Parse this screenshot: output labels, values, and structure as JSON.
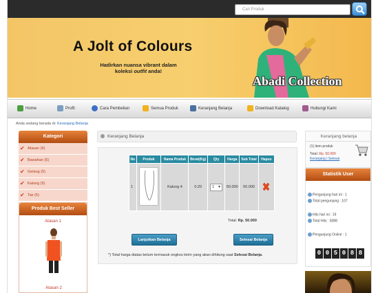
{
  "search": {
    "placeholder": "Cari Produk"
  },
  "banner": {
    "title": "A Jolt of Colours",
    "subtitle_line1": "Hadirkan nuansa vibrant dalam",
    "subtitle_line2": "koleksi outfit anda!",
    "brand": "Abadi Collection"
  },
  "nav": {
    "items": [
      {
        "label": "Home",
        "icon": "home-icon",
        "color": "#4d9e3f"
      },
      {
        "label": "Profil",
        "icon": "profile-icon",
        "color": "#7a9fc0"
      },
      {
        "label": "Cara Pembelian",
        "icon": "globe-icon",
        "color": "#3b6fc4"
      },
      {
        "label": "Semua Produk",
        "icon": "star-icon",
        "color": "#f0b21e"
      },
      {
        "label": "Keranjang Belanja",
        "icon": "cart-icon",
        "color": "#4a6fa0"
      },
      {
        "label": "Download Katalog",
        "icon": "star-icon",
        "color": "#f0b21e"
      },
      {
        "label": "Hubungi Kami",
        "icon": "contact-icon",
        "color": "#a05b8f"
      }
    ]
  },
  "breadcrumb": {
    "prefix": "Anda sedang berada di:",
    "current": "Keranjang Belanja"
  },
  "kategori": {
    "title": "Kategori",
    "items": [
      "Atasan (6)",
      "Bawahan (5)",
      "Gelang (5)",
      "Kalung (5)",
      "Tas (5)"
    ]
  },
  "bestseller": {
    "title": "Produk Best Seller",
    "items": [
      "Atasan 1",
      "Atasan 2"
    ]
  },
  "main": {
    "title": "Keranjang Belanja",
    "table": {
      "headers": [
        "No",
        "Produk",
        "Nama Produk",
        "Berat(Kg)",
        "Qty",
        "Harga",
        "Sub Total",
        "Hapus"
      ],
      "rows": [
        {
          "no": "1",
          "name": "Kalung 4",
          "berat": "0.20",
          "qty": "1",
          "harga": "50.000",
          "subtotal": "50.000"
        }
      ]
    },
    "total_label": "Total:",
    "total_value": "Rp. 50.000",
    "continue_label": "Lanjutkan Belanja",
    "checkout_label": "Selesai Belanja",
    "note_prefix": "*) Total harga diatas belum termasuk ongkos kirim yang akan dihitung saat ",
    "note_bold": "Selesai Belanja",
    "note_suffix": "."
  },
  "cart_box": {
    "title": "Keranjang belanja",
    "count": "(1) item produk",
    "total_label": "Total:",
    "total_value": "Rp. 50.000",
    "link_cart": "Keranjang",
    "link_sep": "|",
    "link_done": "Selesai"
  },
  "stats": {
    "title": "Statistik User",
    "today": "Pengunjung hari ini : 1",
    "total": "Total pengunjung : 107",
    "hits_today": "Hits hari ini : 19",
    "hits_total": "Total Hits : 5088",
    "online": "Pengunjung Online : 1",
    "counter": [
      "0",
      "0",
      "5",
      "0",
      "8",
      "8"
    ]
  },
  "colors": {
    "accent_orange": "#d9692a",
    "table_header": "#2a8ba1",
    "button_blue": "#2b7fb0"
  }
}
